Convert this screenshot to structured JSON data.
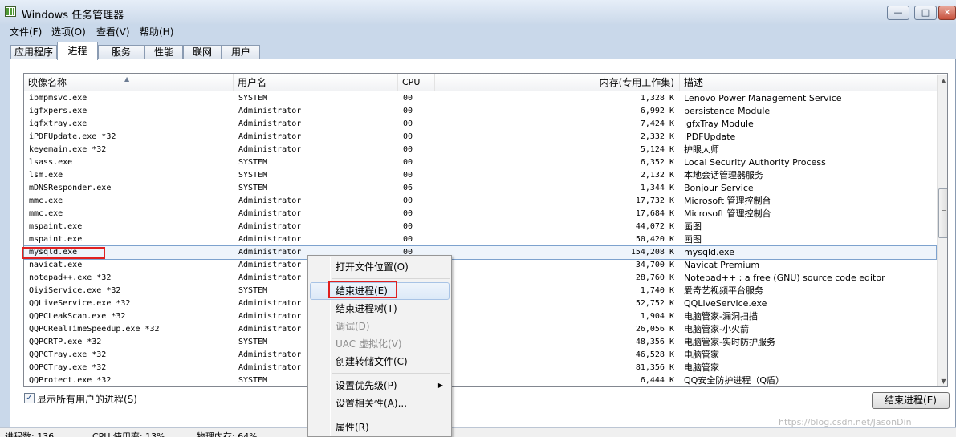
{
  "window": {
    "title": "Windows 任务管理器",
    "controls": {
      "minimize": "—",
      "maximize": "□",
      "close": "✕"
    }
  },
  "menu": [
    "文件(F)",
    "选项(O)",
    "查看(V)",
    "帮助(H)"
  ],
  "tabs": [
    {
      "label": "应用程序",
      "active": false
    },
    {
      "label": "进程",
      "active": true
    },
    {
      "label": "服务",
      "active": false
    },
    {
      "label": "性能",
      "active": false
    },
    {
      "label": "联网",
      "active": false
    },
    {
      "label": "用户",
      "active": false
    }
  ],
  "columns": {
    "name": "映像名称",
    "user": "用户名",
    "cpu": "CPU",
    "mem": "内存(专用工作集)",
    "desc": "描述"
  },
  "processes": [
    {
      "name": "ibmpmsvc.exe",
      "user": "SYSTEM",
      "cpu": "00",
      "mem": "1,328 K",
      "desc": "Lenovo Power Management Service"
    },
    {
      "name": "igfxpers.exe",
      "user": "Administrator",
      "cpu": "00",
      "mem": "6,992 K",
      "desc": "persistence Module"
    },
    {
      "name": "igfxtray.exe",
      "user": "Administrator",
      "cpu": "00",
      "mem": "7,424 K",
      "desc": "igfxTray Module"
    },
    {
      "name": "iPDFUpdate.exe *32",
      "user": "Administrator",
      "cpu": "00",
      "mem": "2,332 K",
      "desc": "iPDFUpdate"
    },
    {
      "name": "keyemain.exe *32",
      "user": "Administrator",
      "cpu": "00",
      "mem": "5,124 K",
      "desc": "护眼大师"
    },
    {
      "name": "lsass.exe",
      "user": "SYSTEM",
      "cpu": "00",
      "mem": "6,352 K",
      "desc": "Local Security Authority Process"
    },
    {
      "name": "lsm.exe",
      "user": "SYSTEM",
      "cpu": "00",
      "mem": "2,132 K",
      "desc": "本地会话管理器服务"
    },
    {
      "name": "mDNSResponder.exe",
      "user": "SYSTEM",
      "cpu": "06",
      "mem": "1,344 K",
      "desc": "Bonjour Service"
    },
    {
      "name": "mmc.exe",
      "user": "Administrator",
      "cpu": "00",
      "mem": "17,732 K",
      "desc": "Microsoft 管理控制台"
    },
    {
      "name": "mmc.exe",
      "user": "Administrator",
      "cpu": "00",
      "mem": "17,684 K",
      "desc": "Microsoft 管理控制台"
    },
    {
      "name": "mspaint.exe",
      "user": "Administrator",
      "cpu": "00",
      "mem": "44,072 K",
      "desc": "画图"
    },
    {
      "name": "mspaint.exe",
      "user": "Administrator",
      "cpu": "00",
      "mem": "50,420 K",
      "desc": "画图"
    },
    {
      "name": "mysqld.exe",
      "user": "Administrator",
      "cpu": "00",
      "mem": "154,208 K",
      "desc": "mysqld.exe",
      "selected": true
    },
    {
      "name": "navicat.exe",
      "user": "Administrator",
      "cpu": "",
      "mem": "34,700 K",
      "desc": "Navicat Premium"
    },
    {
      "name": "notepad++.exe *32",
      "user": "Administrator",
      "cpu": "",
      "mem": "28,760 K",
      "desc": "Notepad++ : a free (GNU) source code editor"
    },
    {
      "name": "QiyiService.exe *32",
      "user": "SYSTEM",
      "cpu": "",
      "mem": "1,740 K",
      "desc": "爱奇艺视频平台服务"
    },
    {
      "name": "QQLiveService.exe *32",
      "user": "Administrator",
      "cpu": "",
      "mem": "52,752 K",
      "desc": "QQLiveService.exe"
    },
    {
      "name": "QQPCLeakScan.exe *32",
      "user": "Administrator",
      "cpu": "",
      "mem": "1,904 K",
      "desc": "电脑管家-漏洞扫描"
    },
    {
      "name": "QQPCRealTimeSpeedup.exe *32",
      "user": "Administrator",
      "cpu": "",
      "mem": "26,056 K",
      "desc": "电脑管家-小火箭"
    },
    {
      "name": "QQPCRTP.exe *32",
      "user": "SYSTEM",
      "cpu": "",
      "mem": "48,356 K",
      "desc": "电脑管家-实时防护服务"
    },
    {
      "name": "QQPCTray.exe *32",
      "user": "Administrator",
      "cpu": "",
      "mem": "46,528 K",
      "desc": "电脑管家"
    },
    {
      "name": "QQPCTray.exe *32",
      "user": "Administrator",
      "cpu": "",
      "mem": "81,356 K",
      "desc": "电脑管家"
    },
    {
      "name": "QQProtect.exe *32",
      "user": "SYSTEM",
      "cpu": "",
      "mem": "6,444 K",
      "desc": "QQ安全防护进程（Q盾）"
    }
  ],
  "context_menu": {
    "items": [
      {
        "label": "打开文件位置(O)",
        "disabled": false
      },
      {
        "label": "结束进程(E)",
        "disabled": false,
        "hover": true
      },
      {
        "label": "结束进程树(T)",
        "disabled": false
      },
      {
        "label": "调试(D)",
        "disabled": true
      },
      {
        "label": "UAC 虚拟化(V)",
        "disabled": true
      },
      {
        "label": "创建转储文件(C)",
        "disabled": false
      },
      {
        "label": "设置优先级(P)",
        "disabled": false,
        "submenu": true
      },
      {
        "label": "设置相关性(A)...",
        "disabled": false
      },
      {
        "label": "属性(R)",
        "disabled": false
      }
    ]
  },
  "show_all_users": {
    "label": "显示所有用户的进程(S)",
    "checked": true,
    "mark": "✓"
  },
  "end_process_button": "结束进程(E)",
  "status": {
    "processes": "进程数: 136",
    "cpu": "CPU 使用率: 13%",
    "memory": "物理内存: 64%"
  },
  "watermark": "https://blog.csdn.net/JasonDin",
  "accent_colors": {
    "highlight_box": "#e02020",
    "selection": "#7da2ce"
  }
}
